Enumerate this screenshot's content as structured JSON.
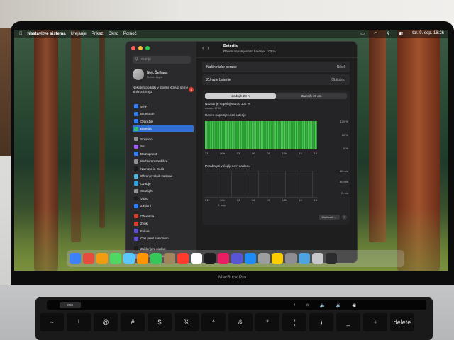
{
  "menubar": {
    "items": [
      "Nastavitve sistema",
      "Urejanje",
      "Prikaz",
      "Okno",
      "Pomoč"
    ],
    "clock": "tor. 9. sep. 18:26"
  },
  "window": {
    "search_placeholder": "Iskanje",
    "user_name": "Nejc Šelhaus",
    "user_sub": "Račun Apple",
    "notice": "Nekateri podatki v storitvi iCloud se ne sinhronizirajo",
    "notice_badge": "1",
    "sidebar_items": [
      {
        "label": "Wi-Fi",
        "color": "#2f7cf6"
      },
      {
        "label": "Bluetooth",
        "color": "#2f7cf6"
      },
      {
        "label": "Omrežje",
        "color": "#2f7cf6"
      },
      {
        "label": "Baterija",
        "color": "#31c759",
        "selected": true
      },
      {
        "label": "Splošno",
        "color": "#8e8e93",
        "gap": true
      },
      {
        "label": "Siri",
        "color": "#a05cf0"
      },
      {
        "label": "Dostopnost",
        "color": "#2f7cf6"
      },
      {
        "label": "Nadzorno središče",
        "color": "#8e8e93"
      },
      {
        "label": "Namizje in Dock",
        "color": "#1c1c1e"
      },
      {
        "label": "Ohranjevalnik zaslona",
        "color": "#4fb6e8"
      },
      {
        "label": "Ozadje",
        "color": "#2ea5e0"
      },
      {
        "label": "Spotlight",
        "color": "#8e8e93"
      },
      {
        "label": "Videz",
        "color": "#1c1c1e"
      },
      {
        "label": "Zasloni",
        "color": "#2f7cf6"
      },
      {
        "label": "Obvestila",
        "color": "#e0382c",
        "gap": true
      },
      {
        "label": "Zvok",
        "color": "#e0382c"
      },
      {
        "label": "Fokus",
        "color": "#5a4fd6"
      },
      {
        "label": "Čas pred zaslonom",
        "color": "#5a4fd6"
      },
      {
        "label": "Zaklenjeni zaslon",
        "color": "#1c1c1e",
        "gap": true
      },
      {
        "label": "Zasebnost in varnost",
        "color": "#2f7cf6"
      }
    ],
    "title": "Baterija",
    "subtitle": "Raven napolnjenosti baterije: 100 %",
    "row1_label": "Način nizke porabe",
    "row1_value": "Nikoli",
    "row2_label": "Zdravje baterije",
    "row2_value": "Običajno",
    "tab_24h": "Zadnjih 24 h",
    "tab_10d": "Zadnjih 10 dni",
    "last_charged": "Nazadnje napolnjeno do 100 %",
    "last_charged_time": "danes, 17:51",
    "level_title": "Raven napolnjenosti baterije",
    "level_ticks": [
      "100 %",
      "50 %",
      "0 %"
    ],
    "time_ticks": [
      "21",
      "00h",
      "03",
      "06",
      "09",
      "12h",
      "15",
      "18"
    ],
    "usage_title": "Poraba pri vklopljenem zaslonu",
    "usage_ticks": [
      "60 min",
      "30 min",
      "0 min"
    ],
    "usage_date": "9. sep.",
    "more_button": "Možnosti ...",
    "help": "?"
  },
  "laptop_label": "MacBook Pro",
  "keyboard": {
    "esc": "esc",
    "keys": [
      "~",
      "!",
      "@",
      "#",
      "$",
      "%",
      "^",
      "&",
      "*",
      "(",
      ")",
      "_",
      "+",
      "delete"
    ],
    "key_subs": [
      "`",
      "1",
      "2",
      "3",
      "4",
      "5",
      "6",
      "7",
      "8",
      "9",
      "0",
      "-",
      "="
    ]
  },
  "chart_data": {
    "type": "bar",
    "title": "Raven napolnjenosti baterije",
    "x": [
      "21",
      "00h",
      "03",
      "06",
      "09",
      "12h",
      "15",
      "18"
    ],
    "ylim": [
      0,
      100
    ],
    "values": [
      100,
      100,
      100,
      100,
      100,
      100,
      100,
      100,
      100,
      100,
      100,
      100,
      100,
      100,
      100,
      100,
      100,
      100,
      100,
      100,
      100,
      100,
      100,
      100,
      100,
      100,
      100,
      100,
      100,
      100,
      100,
      100,
      100,
      100,
      100,
      100,
      100,
      100,
      100,
      100,
      100,
      100,
      100,
      100,
      100,
      100,
      100,
      100,
      100,
      100,
      100,
      100,
      100,
      100,
      100,
      100,
      100,
      100,
      100,
      100,
      100,
      100,
      100,
      100,
      100,
      100,
      100,
      100,
      100,
      100,
      100,
      100,
      100,
      100,
      100,
      100,
      100,
      100,
      100,
      100,
      100,
      100,
      100,
      100,
      100,
      100,
      100,
      100,
      100,
      100,
      100,
      100,
      100,
      100,
      100,
      100
    ]
  }
}
